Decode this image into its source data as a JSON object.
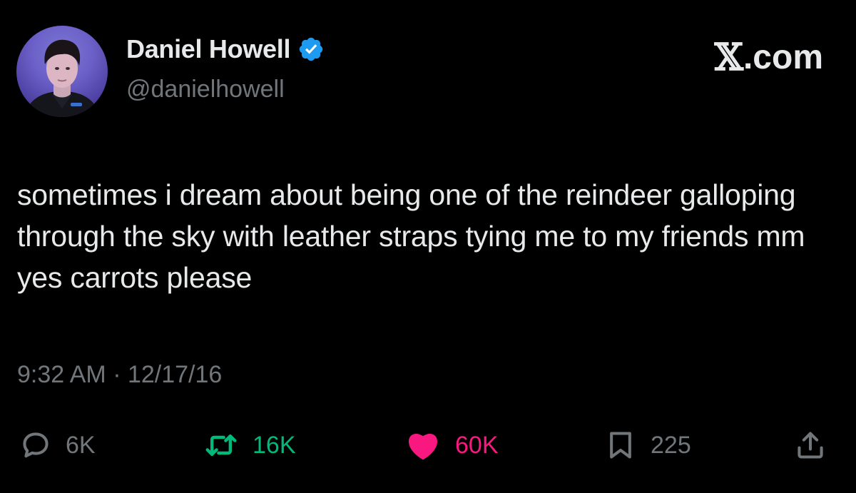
{
  "author": {
    "display_name": "Daniel Howell",
    "handle": "@danielhowell",
    "verified": true,
    "verified_color": "#1d9bf0"
  },
  "brand": {
    "label": ".com",
    "mark": "𝕏"
  },
  "tweet": {
    "text": "sometimes i dream about being one of the reindeer galloping through the sky with leather straps tying me to my friends mm yes carrots please",
    "timestamp": "9:32 AM · 12/17/16"
  },
  "actions": {
    "reply": {
      "icon": "reply-icon",
      "count": "6K",
      "color": "#71767b"
    },
    "retweet": {
      "icon": "retweet-icon",
      "count": "16K",
      "color": "#00ba7c"
    },
    "like": {
      "icon": "heart-icon",
      "count": "60K",
      "color": "#f91880",
      "active": true
    },
    "bookmark": {
      "icon": "bookmark-icon",
      "count": "225",
      "color": "#71767b"
    },
    "share": {
      "icon": "share-icon"
    }
  },
  "colors": {
    "background": "#000000",
    "primary_text": "#e7e9ea",
    "secondary_text": "#71767b"
  }
}
